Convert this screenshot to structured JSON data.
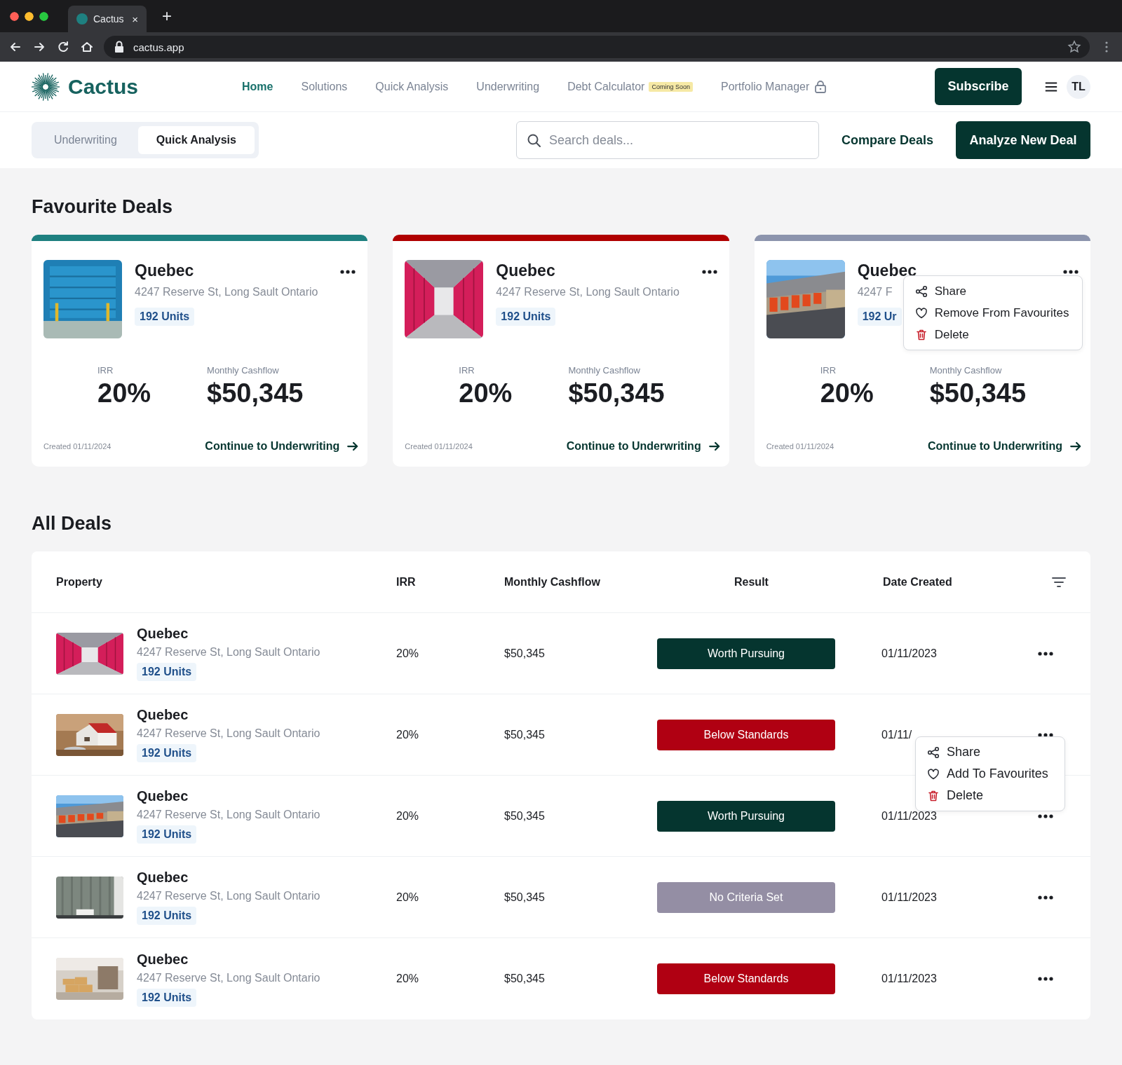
{
  "browser": {
    "tab_title": "Cactus",
    "tab_close": "×",
    "new_tab": "+",
    "url": "cactus.app"
  },
  "nav": {
    "brand": "Cactus",
    "links": [
      {
        "label": "Home",
        "selected": true
      },
      {
        "label": "Solutions",
        "selected": false
      },
      {
        "label": "Quick Analysis",
        "selected": false
      },
      {
        "label": "Underwriting",
        "selected": false
      },
      {
        "label": "Debt Calculator",
        "selected": false,
        "badge": "Coming Soon"
      },
      {
        "label": "Portfolio Manager",
        "selected": false,
        "locked": true
      }
    ],
    "subscribe": "Subscribe",
    "avatar": "TL"
  },
  "toolbar": {
    "tabs": [
      {
        "label": "Underwriting",
        "selected": false
      },
      {
        "label": "Quick Analysis",
        "selected": true
      }
    ],
    "search": {
      "placeholder": "Search deals..."
    },
    "compare": "Compare Deals",
    "analyze": "Analyze New Deal"
  },
  "favourites": {
    "title": "Favourite Deals",
    "cards": [
      {
        "color": "#1e8080",
        "name": "Quebec",
        "address": "4247 Reserve St, Long Sault Ontario",
        "units": "192 Units",
        "irr_label": "IRR",
        "irr": "20%",
        "cashflow_label": "Monthly Cashflow",
        "cashflow": "$50,345",
        "created": "Created 01/11/2024",
        "link": "Continue to Underwriting"
      },
      {
        "color": "#b00000",
        "name": "Quebec",
        "address": "4247 Reserve St, Long Sault Ontario",
        "units": "192 Units",
        "irr_label": "IRR",
        "irr": "20%",
        "cashflow_label": "Monthly Cashflow",
        "cashflow": "$50,345",
        "created": "Created 01/11/2024",
        "link": "Continue to Underwriting"
      },
      {
        "color": "#8c94ad",
        "name": "Quebec",
        "address": "4247 F",
        "units": "192 Ur",
        "irr_label": "IRR",
        "irr": "20%",
        "cashflow_label": "Monthly Cashflow",
        "cashflow": "$50,345",
        "created": "Created 01/11/2024",
        "link": "Continue to Underwriting",
        "menu": [
          {
            "kind": "share",
            "label": "Share"
          },
          {
            "kind": "heart",
            "label": "Remove From Favourites"
          },
          {
            "kind": "delete",
            "label": "Delete"
          }
        ]
      }
    ]
  },
  "all_deals": {
    "title": "All Deals",
    "columns": [
      "Property",
      "IRR",
      "Monthly Cashflow",
      "Result",
      "Date Created"
    ],
    "rows": [
      {
        "name": "Quebec",
        "address": "4247 Reserve St, Long Sault Ontario",
        "units": "192 Units",
        "irr": "20%",
        "cashflow": "$50,345",
        "result": "Worth Pursuing",
        "color": "#05352f",
        "date": "01/11/2023"
      },
      {
        "name": "Quebec",
        "address": "4247 Reserve St, Long Sault Ontario",
        "units": "192 Units",
        "irr": "20%",
        "cashflow": "$50,345",
        "result": "Below Standards",
        "color": "#b00012",
        "date": "01/11/",
        "menu": [
          {
            "kind": "share",
            "label": "Share"
          },
          {
            "kind": "heart",
            "label": "Add To Favourites"
          },
          {
            "kind": "delete",
            "label": "Delete"
          }
        ]
      },
      {
        "name": "Quebec",
        "address": "4247 Reserve St, Long Sault Ontario",
        "units": "192 Units",
        "irr": "20%",
        "cashflow": "$50,345",
        "result": "Worth Pursuing",
        "color": "#05352f",
        "date": "01/11/2023"
      },
      {
        "name": "Quebec",
        "address": "4247 Reserve St, Long Sault Ontario",
        "units": "192 Units",
        "irr": "20%",
        "cashflow": "$50,345",
        "result": "No Criteria Set",
        "color": "#948ea4",
        "date": "01/11/2023"
      },
      {
        "name": "Quebec",
        "address": "4247 Reserve St, Long Sault Ontario",
        "units": "192 Units",
        "irr": "20%",
        "cashflow": "$50,345",
        "result": "Below Standards",
        "color": "#b00012",
        "date": "01/11/2023"
      }
    ]
  }
}
